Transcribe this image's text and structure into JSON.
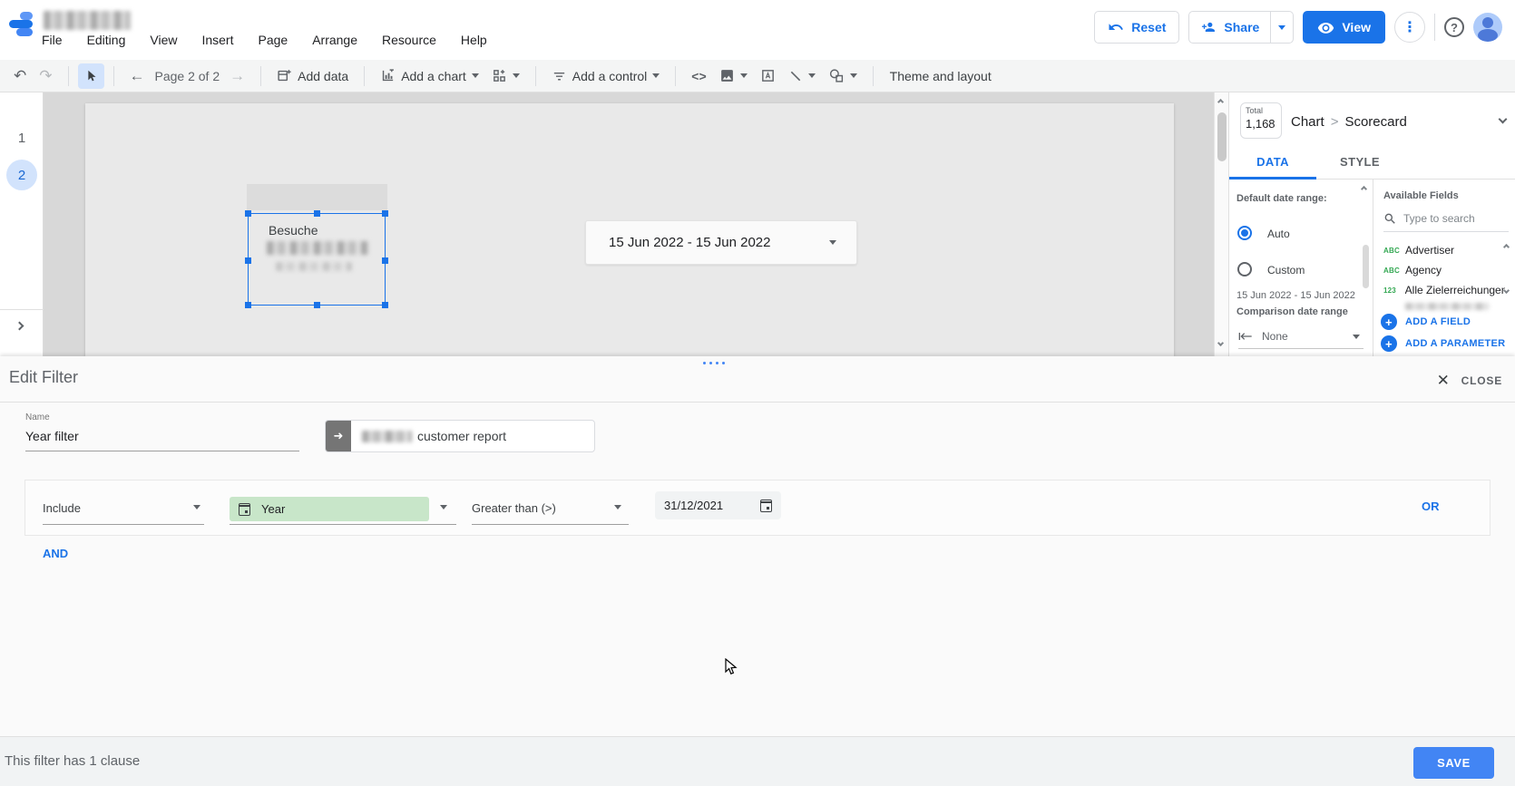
{
  "app": {
    "menu": [
      "File",
      "Editing",
      "View",
      "Insert",
      "Page",
      "Arrange",
      "Resource",
      "Help"
    ],
    "actions": {
      "reset": "Reset",
      "share": "Share",
      "view": "View"
    },
    "colors": {
      "accent": "#1a73e8",
      "save_button": "#4285f4",
      "field_icon_green": "#34a853",
      "selected_chip_green": "#c8e6c9"
    }
  },
  "toolbar": {
    "page_nav": "Page 2 of 2",
    "add_data": "Add data",
    "add_chart": "Add a chart",
    "add_control": "Add a control",
    "theme_and_layout": "Theme and layout"
  },
  "pages": {
    "first": "1",
    "second": "2"
  },
  "canvas": {
    "scorecard_label": "Besuche",
    "date_control_value": "15 Jun 2022 - 15 Jun 2022"
  },
  "panel": {
    "total_label": "Total",
    "total_value": "1,168",
    "breadcrumb_type": "Chart",
    "breadcrumb_sep": ">",
    "breadcrumb_subtype": "Scorecard",
    "tab_data": "DATA",
    "tab_style": "STYLE",
    "default_date_range_label": "Default date range:",
    "radio_auto": "Auto",
    "radio_custom": "Custom",
    "date_range_value": "15 Jun 2022 - 15 Jun 2022",
    "comparison_label": "Comparison date range",
    "comparison_value": "None",
    "fields": {
      "header": "Available Fields",
      "search_placeholder": "Type to search",
      "items": [
        {
          "type": "ABC",
          "name": "Advertiser"
        },
        {
          "type": "ABC",
          "name": "Agency"
        },
        {
          "type": "123",
          "name": "Alle Zielerreichungen"
        }
      ],
      "add_field": "ADD A FIELD",
      "add_parameter": "ADD A PARAMETER"
    }
  },
  "filter_editor": {
    "title": "Edit Filter",
    "close": "CLOSE",
    "name_label": "Name",
    "name_value": "Year filter",
    "datasource_name": "customer report",
    "clause": {
      "include": "Include",
      "field": "Year",
      "operator": "Greater than (>)",
      "value": "31/12/2021",
      "or": "OR"
    },
    "and": "AND",
    "status": "This filter has 1 clause",
    "save": "SAVE"
  }
}
